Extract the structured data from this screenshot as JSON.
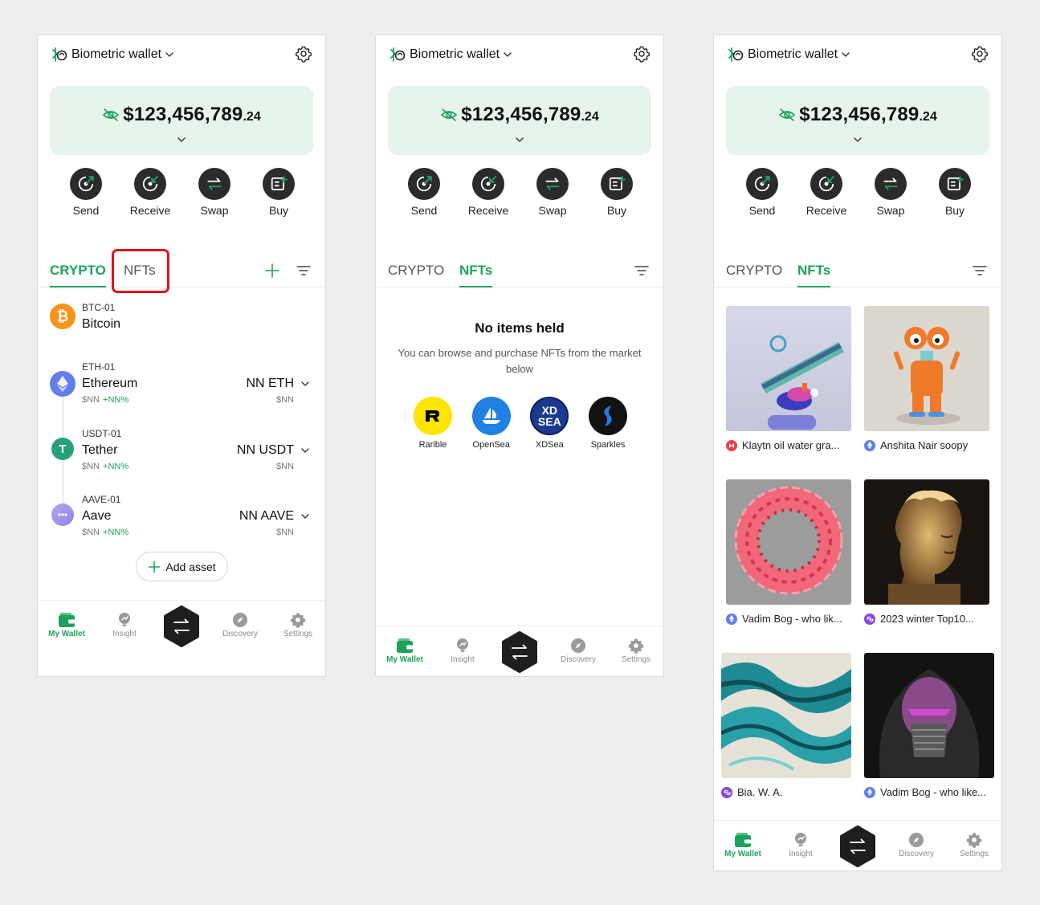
{
  "wallet_name": "Biometric wallet",
  "balance": {
    "main": "$123,456,789",
    "cents": ".24"
  },
  "actions": [
    {
      "label": "Send",
      "icon": "send-icon"
    },
    {
      "label": "Receive",
      "icon": "receive-icon"
    },
    {
      "label": "Swap",
      "icon": "swap-icon"
    },
    {
      "label": "Buy",
      "icon": "buy-icon"
    }
  ],
  "tabs": {
    "crypto": "CRYPTO",
    "nfts": "NFTs"
  },
  "assets": [
    {
      "code": "BTC-01",
      "name": "Bitcoin",
      "color": "#f7931a"
    },
    {
      "code": "ETH-01",
      "name": "Ethereum",
      "fiat": "$NN",
      "change": "+NN%",
      "amount": "NN ETH",
      "amount_fiat": "$NN",
      "color": "#627eea"
    },
    {
      "code": "USDT-01",
      "name": "Tether",
      "fiat": "$NN",
      "change": "+NN%",
      "amount": "NN USDT",
      "amount_fiat": "$NN",
      "color": "#26a17b"
    },
    {
      "code": "AAVE-01",
      "name": "Aave",
      "fiat": "$NN",
      "change": "+NN%",
      "amount": "NN AAVE",
      "amount_fiat": "$NN",
      "color": "#b6509e"
    }
  ],
  "add_asset": "Add asset",
  "nav": {
    "wallet": "My Wallet",
    "insight": "Insight",
    "discovery": "Discovery",
    "settings": "Settings"
  },
  "empty": {
    "title": "No items held",
    "desc": "You can browse and purchase NFTs from the market below"
  },
  "markets": [
    {
      "label": "Rarible"
    },
    {
      "label": "OpenSea"
    },
    {
      "label": "XDSea",
      "logo_text_top": "XD",
      "logo_text_bottom": "SEA"
    },
    {
      "label": "Sparkles"
    }
  ],
  "nfts": [
    {
      "caption": "Klaytn oil water gra...",
      "chain": "klaytn"
    },
    {
      "caption": "Anshita Nair soopy",
      "chain": "ethereum"
    },
    {
      "caption": "Vadim Bog - who lik...",
      "chain": "ethereum"
    },
    {
      "caption": "2023 winter Top10...",
      "chain": "polygon"
    },
    {
      "caption": "Bia. W. A.",
      "chain": "polygon"
    },
    {
      "caption": "Vadim Bog - who like...",
      "chain": "ethereum"
    }
  ],
  "colors": {
    "accent": "#1ca35a",
    "dark": "#2b2b2b",
    "balance_bg": "#e6f4ec",
    "highlight": "#e0141b"
  }
}
